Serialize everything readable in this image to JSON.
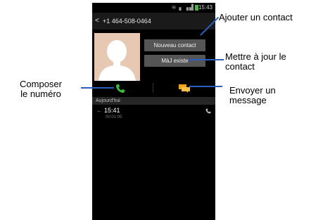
{
  "status_bar": {
    "time": "15:43"
  },
  "title_bar": {
    "number": "+1 464-508-0464"
  },
  "buttons": {
    "new_contact": "Nouveau contact",
    "update_existing": "MàJ existe"
  },
  "call_log": {
    "section": "Aujourd'hui",
    "time": "15:41",
    "duration": "00:01:05"
  },
  "callouts": {
    "add_contact": "Ajouter un contact",
    "update_contact": [
      "Mettre à jour le",
      "contact"
    ],
    "dial_number": [
      "Composer",
      "le numéro"
    ],
    "send_message": [
      "Envoyer un",
      "message"
    ]
  },
  "colors": {
    "call_green": "#3bbf3b",
    "message_orange": "#f0a51a",
    "callout_line": "#2a5fbd"
  }
}
